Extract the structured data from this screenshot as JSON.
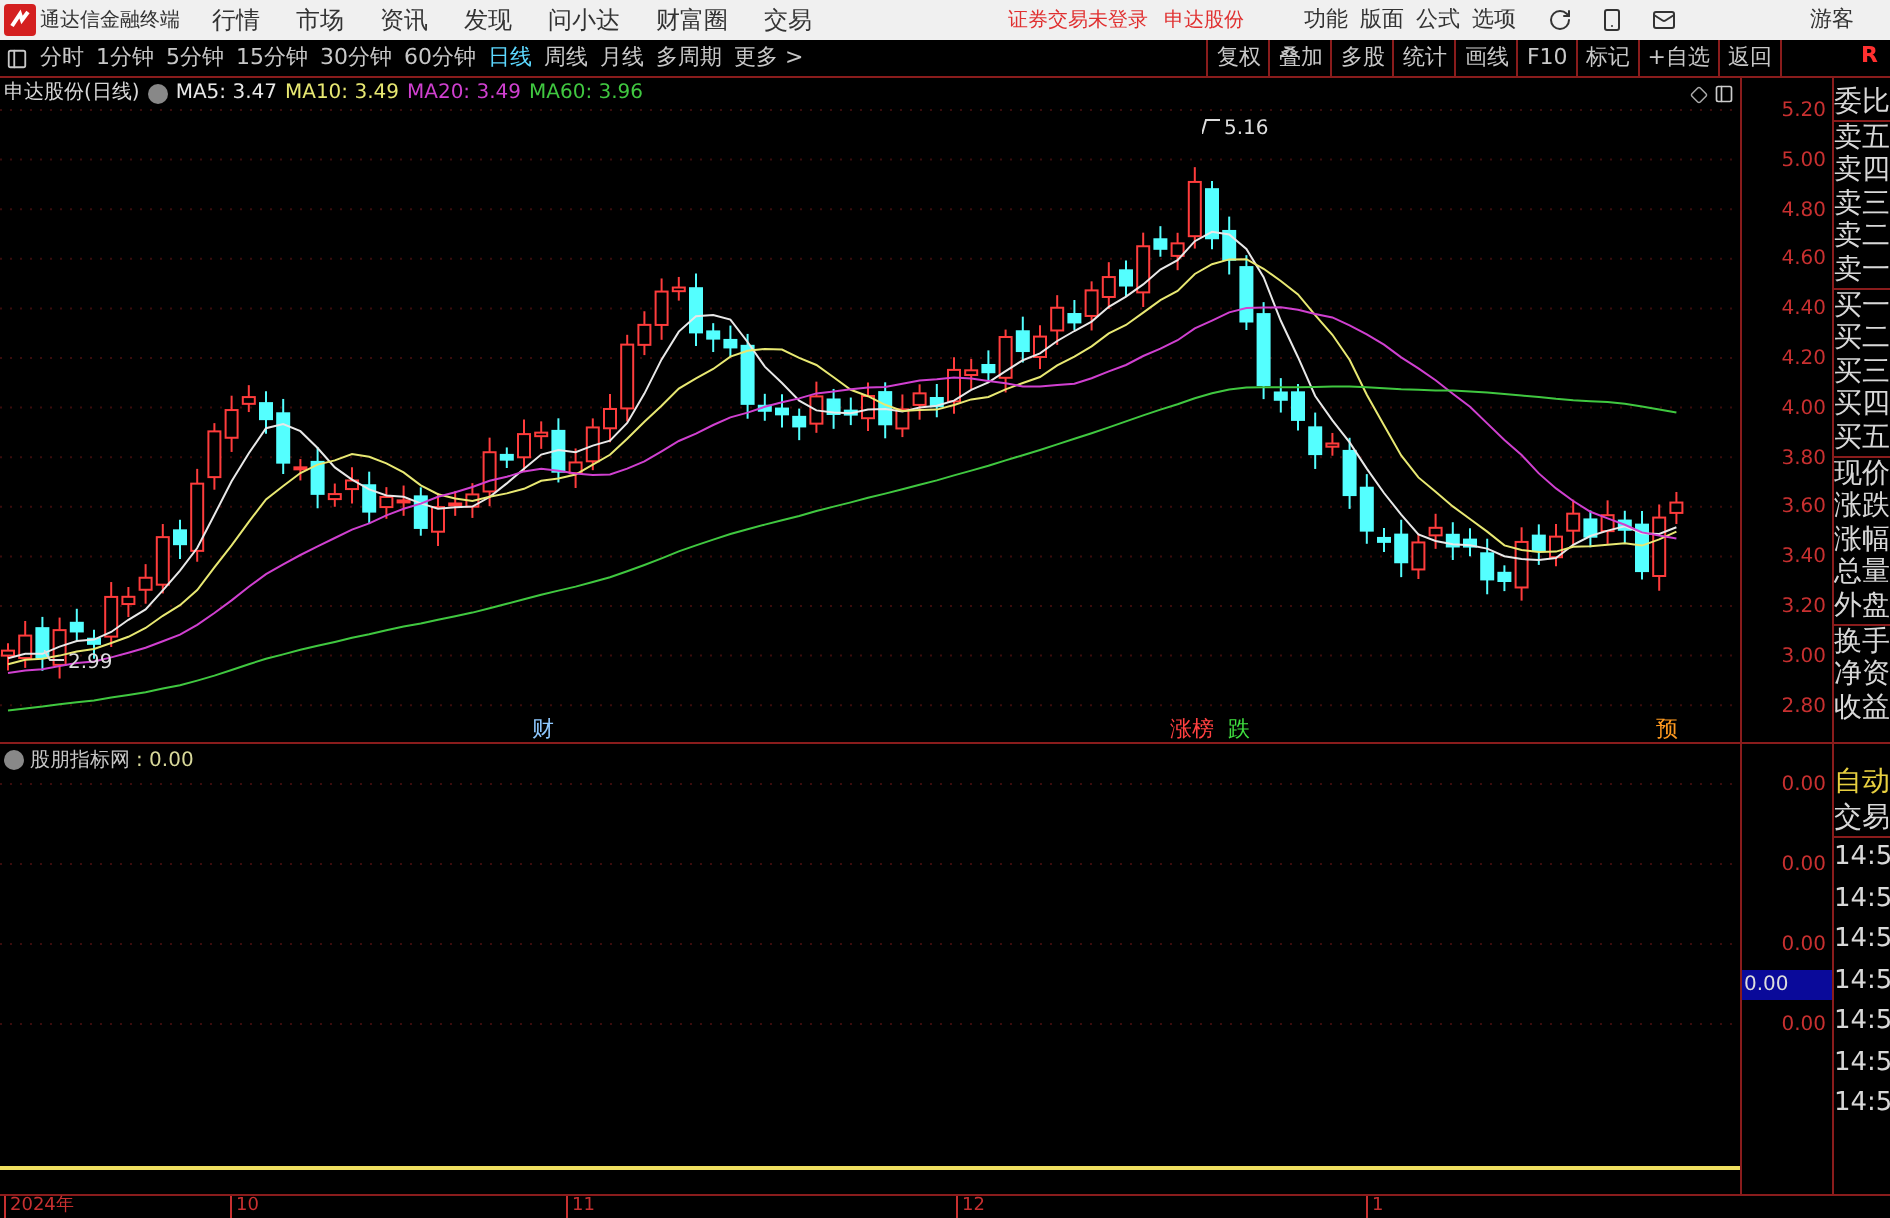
{
  "app": {
    "title": "通达信金融终端",
    "menu": [
      "行情",
      "市场",
      "资讯",
      "发现",
      "问小达",
      "财富圈",
      "交易"
    ],
    "notices": [
      "证券交易未登录",
      "申达股份"
    ],
    "menu_right": [
      "功能",
      "版面",
      "公式",
      "选项"
    ],
    "user": "游客"
  },
  "toolbar": {
    "periods": [
      {
        "label": "分时",
        "selected": false
      },
      {
        "label": "1分钟",
        "selected": false
      },
      {
        "label": "5分钟",
        "selected": false
      },
      {
        "label": "15分钟",
        "selected": false
      },
      {
        "label": "30分钟",
        "selected": false
      },
      {
        "label": "60分钟",
        "selected": false
      },
      {
        "label": "日线",
        "selected": true
      },
      {
        "label": "周线",
        "selected": false
      },
      {
        "label": "月线",
        "selected": false
      },
      {
        "label": "多周期",
        "selected": false
      },
      {
        "label": "更多 >",
        "selected": false
      }
    ],
    "actions": [
      "复权",
      "叠加",
      "多股",
      "统计",
      "画线",
      "F10",
      "标记",
      "+自选",
      "返回"
    ],
    "corner": "R"
  },
  "chart": {
    "stock": "申达股份(日线)",
    "ma": [
      {
        "label": "MA5:",
        "value": "3.47",
        "color": "#e8e8e8"
      },
      {
        "label": "MA10:",
        "value": "3.49",
        "color": "#e8e872"
      },
      {
        "label": "MA20:",
        "value": "3.49",
        "color": "#d040d0"
      },
      {
        "label": "MA60:",
        "value": "3.96",
        "color": "#40c840"
      }
    ],
    "high_label": "5.16",
    "low_label": "2.99",
    "markers": [
      {
        "text": "财",
        "kind": "news"
      },
      {
        "text": "涨榜",
        "kind": "up"
      },
      {
        "text": "跌",
        "kind": "down"
      },
      {
        "text": "预",
        "kind": "forecast"
      }
    ],
    "price_axis": [
      "5.20",
      "5.00",
      "4.80",
      "4.60",
      "4.40",
      "4.20",
      "4.00",
      "3.80",
      "3.60",
      "3.40",
      "3.20",
      "3.00",
      "2.80"
    ]
  },
  "quote_panel": {
    "groups": [
      [
        "委比"
      ],
      [
        "卖五",
        "卖四",
        "卖三",
        "卖二",
        "卖一"
      ],
      [
        "买一",
        "买二",
        "买三",
        "买四",
        "买五"
      ],
      [
        "现价",
        "涨跌",
        "涨幅",
        "总量",
        "外盘"
      ],
      [
        "换手",
        "净资",
        "收益"
      ]
    ]
  },
  "indicator": {
    "name": "股朋指标网",
    "value": ": 0.00",
    "axis": [
      "0.00",
      "0.00",
      "0.00",
      "0.00"
    ],
    "current": "0.00"
  },
  "trades": {
    "mode": "自动",
    "title": "交易",
    "times": [
      "14:5",
      "14:5",
      "14:5",
      "14:5",
      "14:5",
      "14:5",
      "14:5"
    ]
  },
  "date_axis": [
    "2024年",
    "10",
    "11",
    "12",
    "1"
  ]
}
